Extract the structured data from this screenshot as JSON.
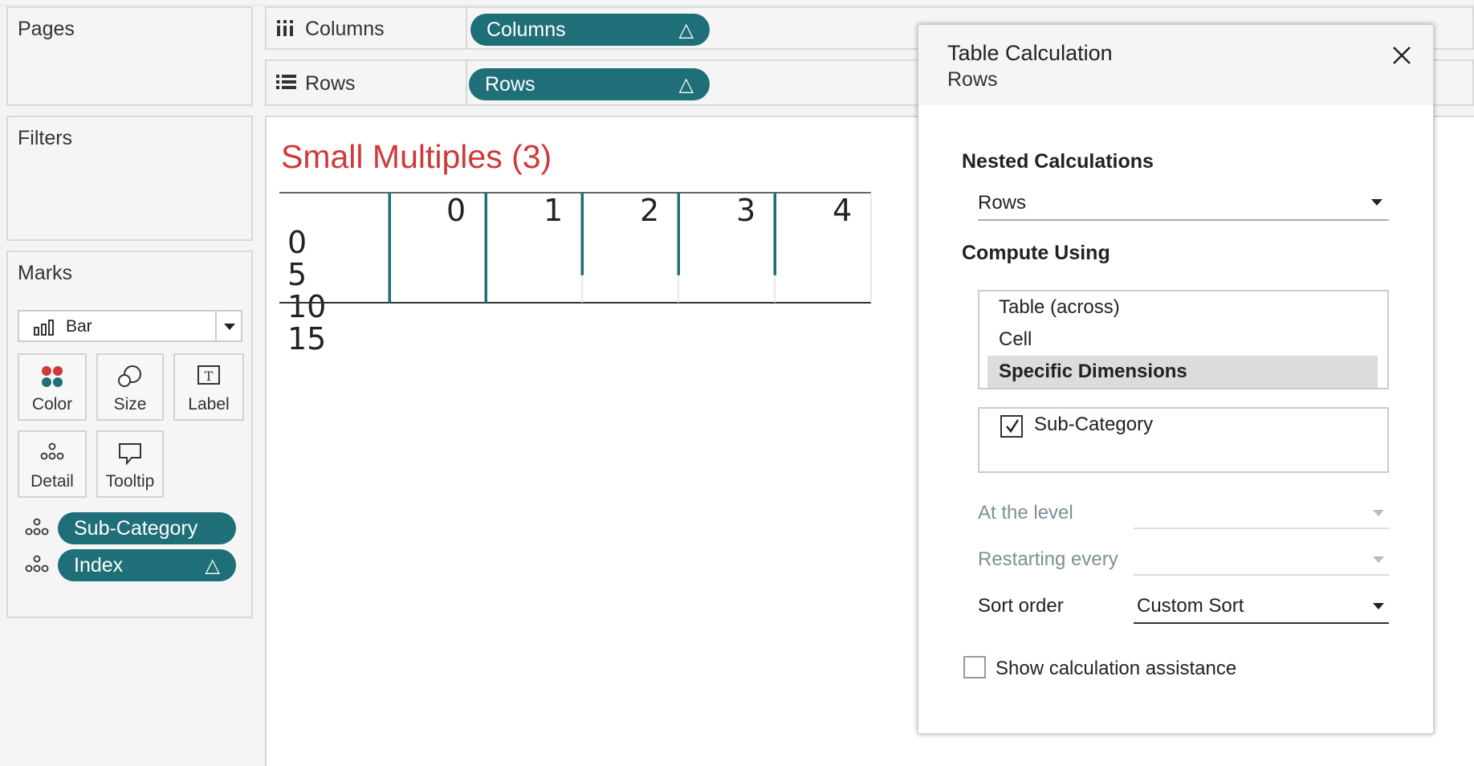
{
  "cards": {
    "pages": "Pages",
    "filters": "Filters",
    "marks": "Marks"
  },
  "shelves": {
    "columns_label": "Columns",
    "columns_pill": "Columns",
    "rows_label": "Rows",
    "rows_pill": "Rows",
    "delta": "△"
  },
  "marks": {
    "type": "Bar",
    "buttons": {
      "color": "Color",
      "size": "Size",
      "label": "Label",
      "detail": "Detail",
      "tooltip": "Tooltip"
    },
    "pills": [
      {
        "label": "Sub-Category",
        "delta": ""
      },
      {
        "label": "Index",
        "delta": "△"
      }
    ]
  },
  "view": {
    "title": "Small Multiples (3)",
    "title_color": "#d0393a",
    "col_headers": [
      "0",
      "1",
      "2",
      "3",
      "4"
    ],
    "row_ticks": [
      "0",
      "5",
      "10",
      "15"
    ]
  },
  "chart_data": {
    "type": "bar",
    "title": "Small Multiples (3)",
    "categories": [
      "0",
      "1",
      "2",
      "3",
      "4"
    ],
    "y_ticks": [
      "0",
      "5",
      "10",
      "15"
    ],
    "ylim": [
      0,
      16
    ],
    "panels": [
      {
        "column": "0",
        "value": 17
      },
      {
        "column": "1",
        "value": 17
      },
      {
        "column": "2",
        "value": 12
      },
      {
        "column": "3",
        "value": 12
      },
      {
        "column": "4",
        "value": 12
      }
    ],
    "bar_color": "#1f6f78"
  },
  "dialog": {
    "title": "Table Calculation",
    "subtitle": "Rows",
    "nested_header": "Nested Calculations",
    "nested_value": "Rows",
    "compute_header": "Compute Using",
    "compute_options": [
      "Table (across)",
      "Cell",
      "Specific Dimensions"
    ],
    "compute_selected": "Specific Dimensions",
    "dimensions": [
      {
        "label": "Sub-Category",
        "checked": true
      }
    ],
    "at_level_label": "At the level",
    "at_level_value": "",
    "restart_label": "Restarting every",
    "restart_value": "",
    "sort_label": "Sort order",
    "sort_value": "Custom Sort",
    "assist_label": "Show calculation assistance",
    "assist_checked": false
  },
  "colors": {
    "accent": "#1f6f78",
    "title_red": "#d0393a",
    "disabled_text": "#7c8f96"
  }
}
